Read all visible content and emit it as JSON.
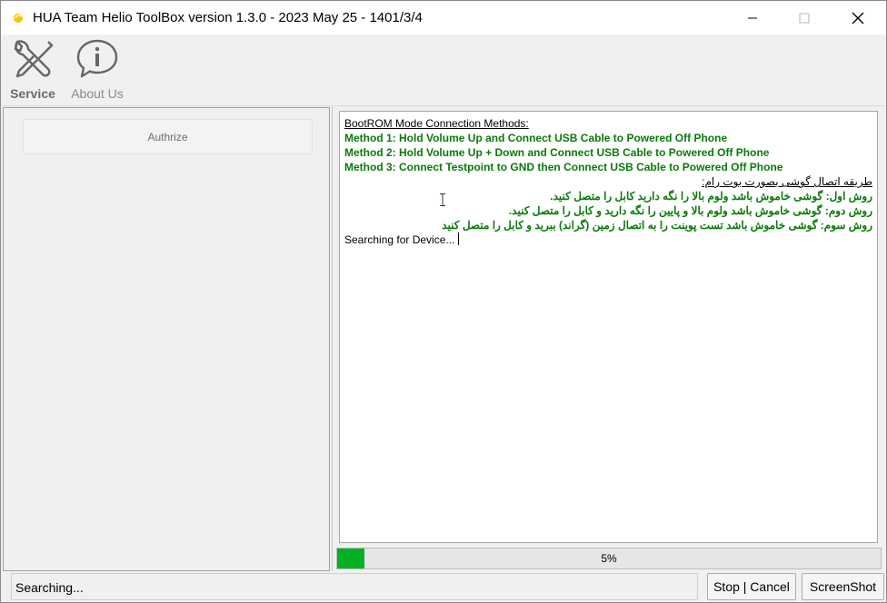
{
  "window": {
    "title": "HUA Team Helio ToolBox version 1.3.0 - 2023 May 25 - 1401/3/4"
  },
  "toolbar": {
    "service_label": "Service",
    "about_label": "About Us",
    "service_icon": "tools-icon",
    "about_icon": "info-bubble-icon"
  },
  "left_panel": {
    "authrize_label": "Authrize"
  },
  "log": {
    "lines": [
      "BootROM Mode Connection Methods:",
      "Method 1: Hold Volume Up and Connect USB Cable to Powered Off Phone",
      "Method 2: Hold Volume Up + Down and Connect USB Cable to Powered Off Phone",
      "Method 3: Connect Testpoint to GND then Connect USB Cable to Powered Off Phone",
      "طریقه اتصال گوشی بصورت بوت رام:",
      "روش اول: گوشی خاموش باشد ولوم بالا را نگه دارید کابل را متصل کنید.",
      "روش دوم: گوشی خاموش باشد ولوم بالا و پایین را نگه دارید و کابل را متصل کنید.",
      "روش سوم: گوشی خاموش باشد تست پوینت را به اتصال زمین (گراند) ببرید و کابل را متصل کنید",
      "Searching for Device..."
    ]
  },
  "progress": {
    "value": 0.05,
    "label": "5%",
    "color": "#06b025"
  },
  "status": {
    "text": "Searching...",
    "stop_label": "Stop | Cancel",
    "screenshot_label": "ScreenShot"
  },
  "colors": {
    "method_text": "#0a7a0a"
  }
}
